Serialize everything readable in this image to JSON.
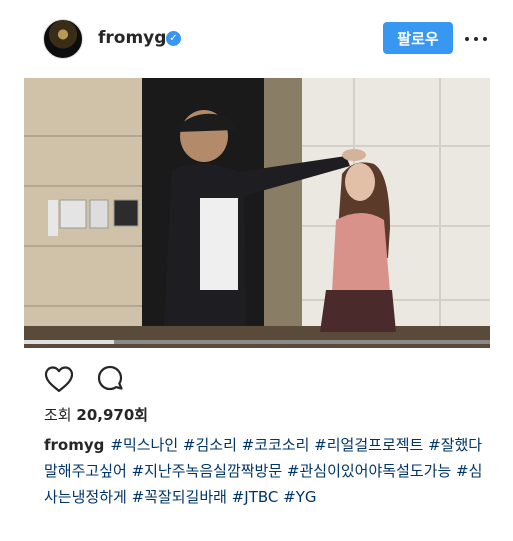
{
  "post": {
    "username": "fromyg",
    "follow_label": "팔로우",
    "views_label": "조회",
    "views_count": "20,970회",
    "caption_user": "fromyg",
    "caption_tags": "#믹스나인 #김소리 #코코소리 #리얼걸프로젝트 #잘했다말해주고싶어 #지난주녹음실깜짝방문 #관심이있어야독설도가능 #심사는냉정하게 #꼭잘되길바래 #JTBC #YG"
  },
  "icons": {
    "verified": "verified-badge-icon",
    "more": "more-options-icon",
    "like": "heart-icon",
    "comment": "comment-icon"
  },
  "colors": {
    "accent": "#3897f0",
    "hashtag": "#003569",
    "text": "#262626"
  }
}
